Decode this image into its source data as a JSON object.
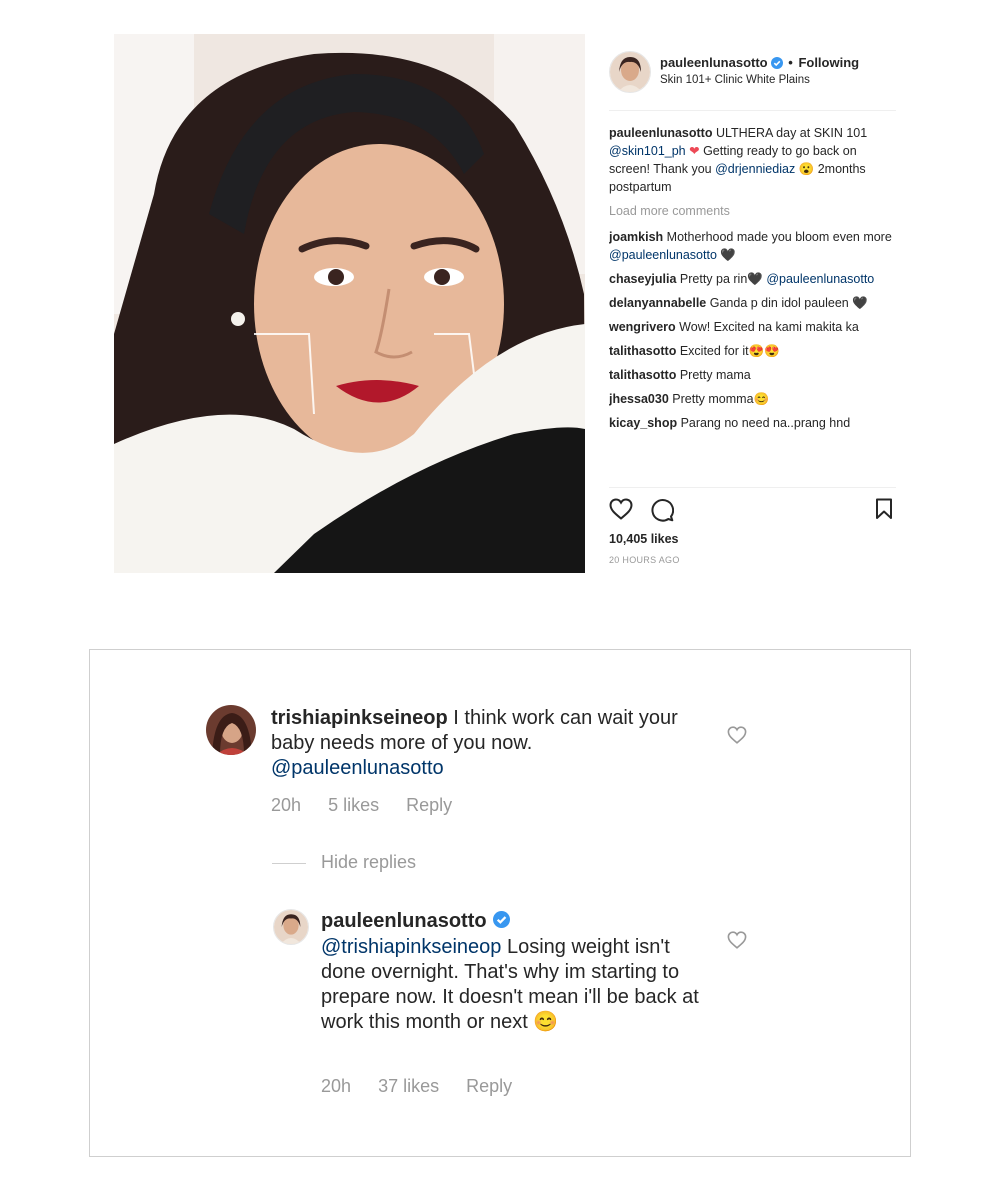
{
  "post": {
    "username": "pauleenlunasotto",
    "follow_status": "Following",
    "location": "Skin 101+ Clinic White Plains",
    "caption": {
      "user": "pauleenlunasotto",
      "parts": [
        "ULTHERA day at SKIN 101 ",
        "@skin101_ph",
        " ",
        "❤",
        " Getting ready to go back on screen! Thank you ",
        "@drjenniediaz",
        " 😮 2months postpartum"
      ]
    },
    "load_more": "Load more comments",
    "comments": [
      {
        "user": "joamkish",
        "text": "Motherhood made you bloom even more ",
        "mention": "@pauleenlunasotto",
        "after": " 🖤"
      },
      {
        "user": "chaseyjulia",
        "text": "Pretty pa rin🖤 ",
        "mention": "@pauleenlunasotto",
        "after": ""
      },
      {
        "user": "delanyannabelle",
        "text": "Ganda p din idol pauleen 🖤",
        "mention": "",
        "after": ""
      },
      {
        "user": "wengrivero",
        "text": "Wow! Excited na kami makita ka",
        "mention": "",
        "after": ""
      },
      {
        "user": "talithasotto",
        "text": "Excited for it😍😍",
        "mention": "",
        "after": ""
      },
      {
        "user": "talithasotto",
        "text": "Pretty mama",
        "mention": "",
        "after": ""
      },
      {
        "user": "jhessa030",
        "text": "Pretty momma😊",
        "mention": "",
        "after": ""
      },
      {
        "user": "kicay_shop",
        "text": "Parang no need na..prang hnd",
        "mention": "",
        "after": ""
      }
    ],
    "likes": "10,405 likes",
    "time_ago": "20 HOURS AGO",
    "icons": {
      "like": "heart-icon",
      "comment": "comment-icon",
      "save": "bookmark-icon"
    },
    "colors": {
      "accent": "#3897f0",
      "heart": "#ed4956",
      "mention": "#003569"
    }
  },
  "zoom": {
    "comment": {
      "user": "trishiapinkseineop",
      "text": "I think work can wait your baby needs more of you now.",
      "mention": "@pauleenlunasotto",
      "time": "20h",
      "likes": "5 likes",
      "reply": "Reply"
    },
    "hide_replies": "Hide replies",
    "reply": {
      "user": "pauleenlunasotto",
      "mention": "@trishiapinkseineop",
      "text": "Losing weight isn't done overnight. That's why im starting to prepare now. It doesn't mean i'll be back at work this month or next",
      "emoji": "😊",
      "time": "20h",
      "likes": "37 likes",
      "reply": "Reply"
    }
  }
}
